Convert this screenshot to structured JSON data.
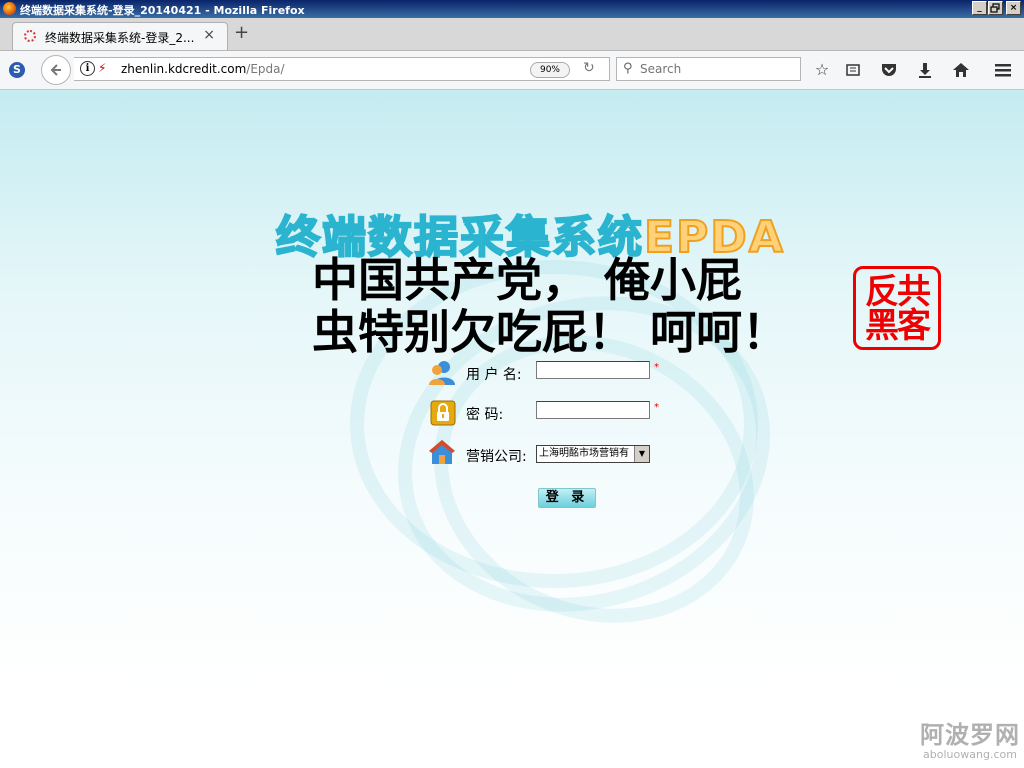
{
  "window": {
    "title": "终端数据采集系统-登录_20140421 - Mozilla Firefox",
    "controls": [
      "_",
      "▫",
      "×"
    ]
  },
  "tab": {
    "title": "终端数据采集系统-登录_2...",
    "close": "×",
    "new_tab": "+"
  },
  "navbar": {
    "url_host": "zhenlin.kdcredit.com",
    "url_path": "/Epda/",
    "zoom": "90%",
    "search_placeholder": "Search"
  },
  "icons": {
    "bookmark": "bookmark-star-icon",
    "reading_list": "reading-list-icon",
    "pocket": "pocket-icon",
    "download": "download-icon",
    "home": "home-icon",
    "menu": "hamburger-menu-icon"
  },
  "page": {
    "system_title_cn": "终端数据采集系统",
    "system_title_en": "EPDA",
    "slogan_line1": "中国共产党， 俺小屁",
    "slogan_line2": "虫特别欠吃屁！ 呵呵！",
    "stamp": "反共黑客",
    "form": {
      "username_label": "用 户 名:",
      "password_label": "密    码:",
      "company_label": "营销公司:",
      "company_selected": "上海明酩市场营销有",
      "required_mark": "*",
      "login_button": "登 录"
    }
  },
  "watermark": {
    "cn": "阿波罗网",
    "en": "aboluowang.com"
  },
  "colors": {
    "title_cyan": "#2bb4cf",
    "title_orange": "#f0a020",
    "stamp_red": "#e00000",
    "page_bg_top": "#c4ecf1"
  }
}
